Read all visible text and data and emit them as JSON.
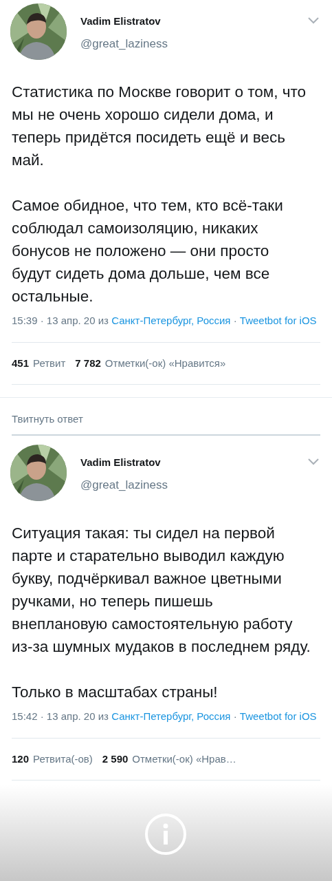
{
  "tweets": [
    {
      "name": "Vadim Elistratov",
      "handle": "@great_laziness",
      "paragraphs": [
        "Статистика по Москве говорит о том, что мы не очень хорошо сидели дома, и теперь придётся посидеть ещё и весь май.",
        "Самое обидное, что тем, кто всё-таки соблюдал самоизоляцию, никаких бонусов не положено — они просто будут сидеть дома дольше, чем все остальные."
      ],
      "time": "15:39 · 13 апр. 20 из",
      "location": "Санкт-Петербург, Россия",
      "separator": "·",
      "client": "Tweetbot for iOS",
      "stats": [
        {
          "count": "451",
          "label": "Ретвит"
        },
        {
          "count": "7 782",
          "label": "Отметки(-ок) «Нравится»"
        }
      ]
    },
    {
      "name": "Vadim Elistratov",
      "handle": "@great_laziness",
      "paragraphs": [
        "Ситуация такая: ты сидел на первой парте и старательно выводил каждую букву, подчёркивал важное цветными ручками, но теперь пишешь внеплановую самостоятельную работу из-за шумных мудаков в последнем ряду.",
        "Только в масштабах страны!"
      ],
      "time": "15:42 · 13 апр. 20 из",
      "location": "Санкт-Петербург, Россия",
      "separator": "·",
      "client": "Tweetbot for iOS",
      "stats": [
        {
          "count": "120",
          "label": "Ретвита(-ов)"
        },
        {
          "count": "2 590",
          "label": "Отметки(-ок) «Нрав…"
        }
      ]
    }
  ],
  "reply_prompt": "Твитнуть ответ"
}
